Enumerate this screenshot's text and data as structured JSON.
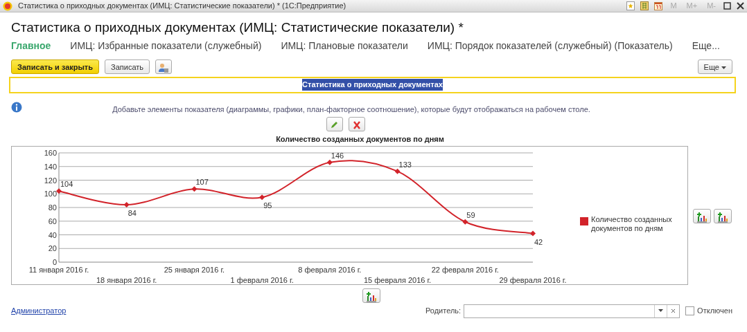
{
  "window": {
    "title": "Статистика о приходных документах (ИМЦ: Статистические показатели) * (1С:Предприятие)",
    "memory_buttons": [
      "M",
      "M+",
      "M-"
    ]
  },
  "heading": "Статистика о приходных документах (ИМЦ: Статистические показатели) *",
  "tabs": [
    {
      "label": "Главное",
      "selected": true
    },
    {
      "label": "ИМЦ: Избранные показатели (служебный)",
      "selected": false
    },
    {
      "label": "ИМЦ: Плановые показатели",
      "selected": false
    },
    {
      "label": "ИМЦ: Порядок показателей (служебный) (Показатель)",
      "selected": false
    }
  ],
  "tabs_more": "Еще...",
  "toolbar": {
    "buttons": [
      {
        "kind": "primary",
        "label": "Записать и закрыть"
      },
      {
        "kind": "default",
        "label": "Записать"
      },
      {
        "kind": "icon"
      }
    ],
    "more": "Еще"
  },
  "name_field": {
    "value": "Статистика о приходных документах",
    "text_selected": true
  },
  "hint": "Добавьте элементы показателя (диаграммы, графики, план-факторное соотношение), которые будут отображаться на рабочем столе.",
  "chart": {
    "chart_data": {
      "type": "line",
      "title": "Количество созданных документов по дням",
      "categories": [
        "11 января 2016 г.",
        "18 января 2016 г.",
        "25 января 2016 г.",
        "1 февраля 2016 г.",
        "8 февраля 2016 г.",
        "15 февраля 2016 г.",
        "22 февраля 2016 г.",
        "29 февраля 2016 г."
      ],
      "series": [
        {
          "name": "Количество созданных документов по дням",
          "color": "#d2232a",
          "marker": "diamond",
          "values": [
            104,
            84,
            107,
            95,
            146,
            133,
            59,
            42
          ]
        }
      ],
      "grid": true,
      "ylim": [
        0,
        160
      ],
      "yticks": [
        0,
        20,
        40,
        60,
        80,
        100,
        120,
        140,
        160
      ],
      "data_labels": true
    }
  },
  "author_link": "Администратор",
  "parent": {
    "label": "Родитель:"
  },
  "disabled": {
    "label": "Отключен",
    "checked": false
  }
}
